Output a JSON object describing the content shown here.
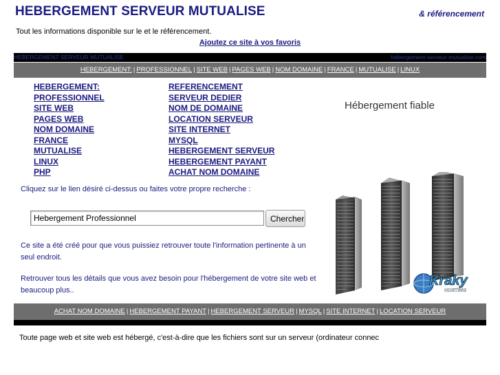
{
  "header": {
    "title": "HEBERGEMENT SERVEUR MUTUALISE",
    "tagline": "& référencement",
    "intro": "Tout les informations disponible sur le et le référencement.",
    "favorite_link": "Ajoutez ce site à vos favoris"
  },
  "black_bar": {
    "left_text": "HEBERGEMENT SERVEUR MUTUALISE",
    "right_text": "hebergement-serveur-mutualise.com"
  },
  "nav_top": [
    "HEBERGEMENT:",
    "PROFESSIONNEL",
    "SITE WEB",
    "PAGES WEB",
    "NOM DOMAINE",
    "FRANCE",
    "MUTUALISE",
    "LINUX"
  ],
  "links_left": [
    "HEBERGEMENT:",
    "PROFESSIONNEL",
    "SITE WEB",
    "PAGES WEB",
    "NOM DOMAINE",
    "FRANCE",
    "MUTUALISE",
    "LINUX",
    "PHP"
  ],
  "links_right": [
    "REFERENCEMENT",
    "SERVEUR DEDIER",
    "NOM DE DOMAINE",
    "LOCATION SERVEUR",
    "SITE INTERNET",
    "MYSQL",
    "HEBERGEMENT SERVEUR",
    "HEBERGEMENT PAYANT",
    "ACHAT NOM DOMAINE"
  ],
  "ad": {
    "title": "Hébergement fiable",
    "logo_text": "Kraky",
    "logo_sub": "HOSTING"
  },
  "search": {
    "prompt": "Cliquez sur le lien désiré ci-dessus ou faites votre propre recherche :",
    "value": "Hebergement Professionnel",
    "button_label": "Chercher"
  },
  "paragraphs": [
    "Ce site a été créé pour que vous puissiez retrouver toute l'information pertinente à un seul endroit.",
    "Retrouver tous les détails que vous avez besoin pour l'hébergement de votre site web et beaucoup plus.."
  ],
  "nav_bottom": [
    "ACHAT NOM DOMAINE",
    "HEBERGEMENT PAYANT",
    "HEBERGEMENT SERVEUR",
    "MYSQL",
    "SITE INTERNET",
    "LOCATION SERVEUR"
  ],
  "footer": {
    "text": "Toute page web et site web est hébergé, c'est-à-dire que les fichiers sont sur un serveur (ordinateur connec"
  }
}
